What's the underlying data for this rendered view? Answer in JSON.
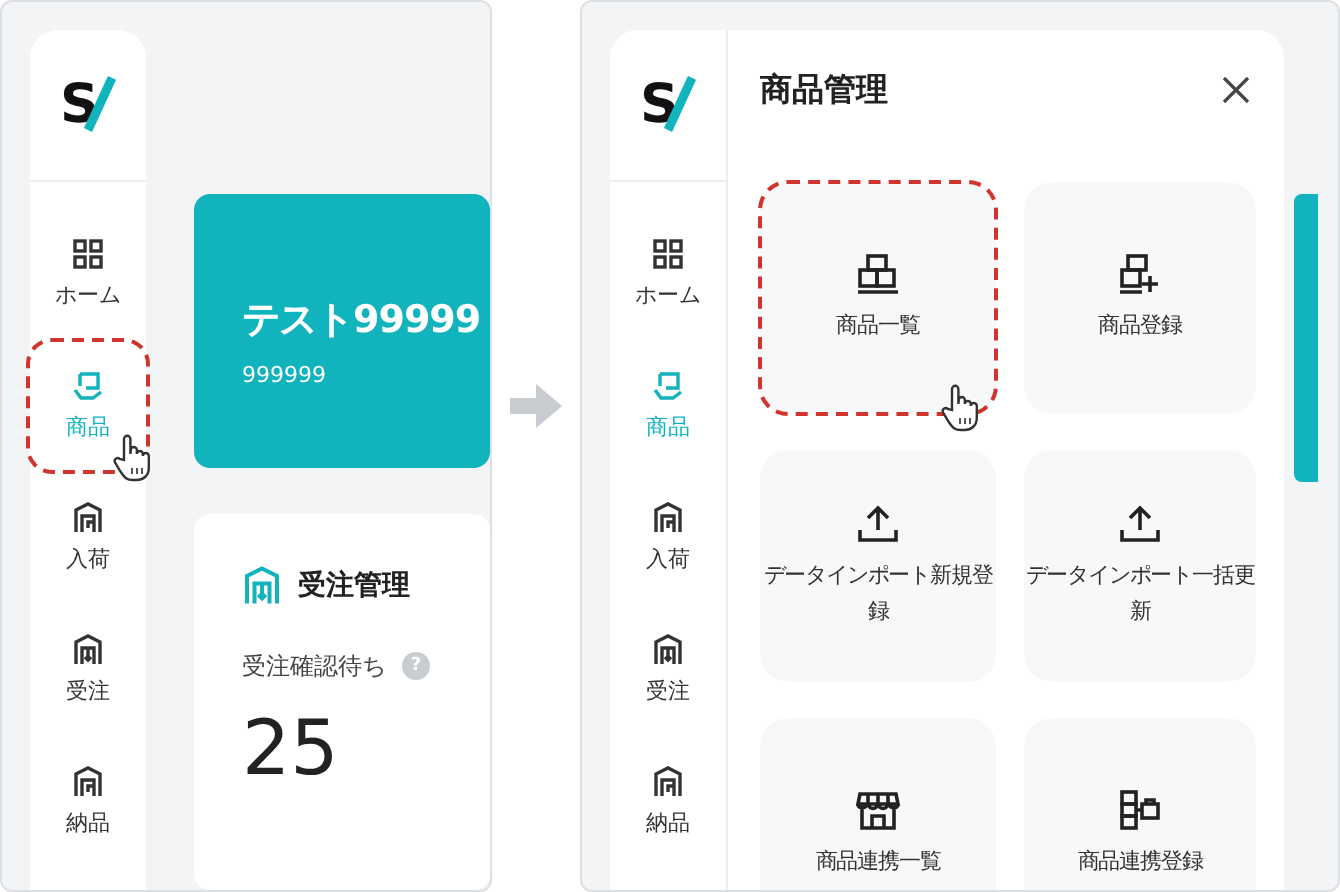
{
  "left_screen": {
    "logo": "S",
    "sidebar": {
      "items": [
        {
          "label": "ホーム",
          "selected": false,
          "highlighted": false
        },
        {
          "label": "商品",
          "selected": true,
          "highlighted": true
        },
        {
          "label": "入荷",
          "selected": false,
          "highlighted": false
        },
        {
          "label": "受注",
          "selected": false,
          "highlighted": false
        },
        {
          "label": "納品",
          "selected": false,
          "highlighted": false
        }
      ]
    },
    "banner": {
      "title": "テスト99999",
      "subtitle": "999999"
    },
    "card": {
      "title": "受注管理",
      "metric_label": "受注確認待ち",
      "help": "?",
      "metric_value": "25"
    }
  },
  "right_screen": {
    "logo": "S",
    "sidebar": {
      "items": [
        {
          "label": "ホーム",
          "selected": false
        },
        {
          "label": "商品",
          "selected": true
        },
        {
          "label": "入荷",
          "selected": false
        },
        {
          "label": "受注",
          "selected": false
        },
        {
          "label": "納品",
          "selected": false
        }
      ]
    },
    "panel": {
      "title": "商品管理",
      "tiles": [
        {
          "label": "商品一覧",
          "highlighted": true
        },
        {
          "label": "商品登録",
          "highlighted": false
        },
        {
          "label": "データインポート新規登録",
          "highlighted": false
        },
        {
          "label": "データインポート一括更新",
          "highlighted": false
        },
        {
          "label": "商品連携一覧",
          "highlighted": false
        },
        {
          "label": "商品連携登録",
          "highlighted": false
        }
      ]
    }
  }
}
